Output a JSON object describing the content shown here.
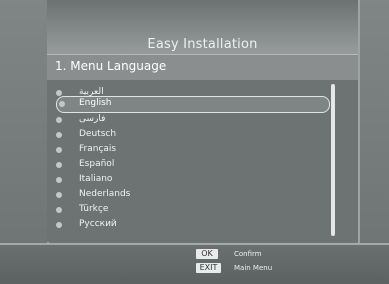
{
  "screen": {
    "title": "Easy Installation",
    "section_title": "1. Menu Language"
  },
  "languages": [
    {
      "label": "العربية",
      "selected": false
    },
    {
      "label": "English",
      "selected": true
    },
    {
      "label": "فارسی",
      "selected": false
    },
    {
      "label": "Deutsch",
      "selected": false
    },
    {
      "label": "Français",
      "selected": false
    },
    {
      "label": "Español",
      "selected": false
    },
    {
      "label": "Italiano",
      "selected": false
    },
    {
      "label": "Nederlands",
      "selected": false
    },
    {
      "label": "Türkçe",
      "selected": false
    },
    {
      "label": "Русский",
      "selected": false
    }
  ],
  "footer": {
    "ok_key": "OK",
    "ok_label": "Confirm",
    "exit_key": "EXIT",
    "exit_label": "Main Menu"
  }
}
